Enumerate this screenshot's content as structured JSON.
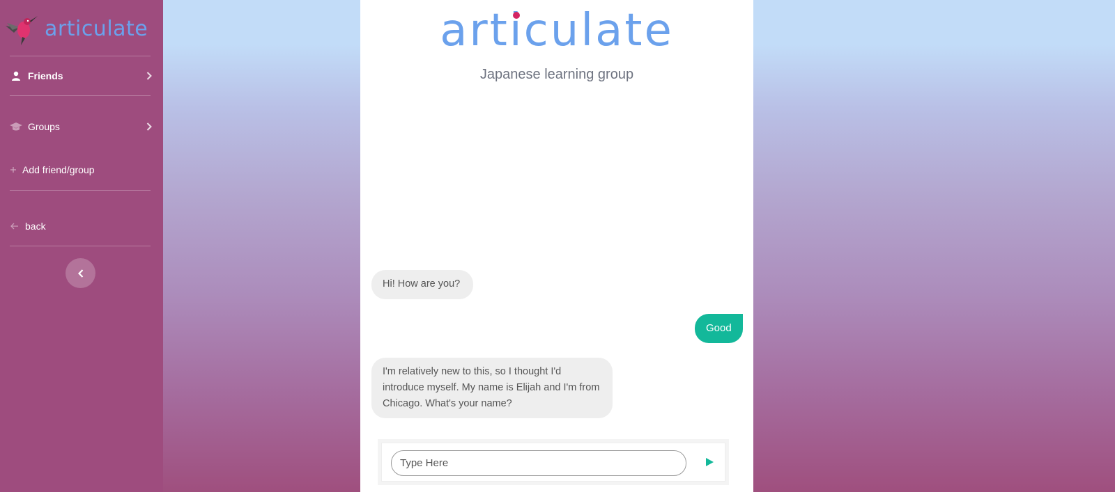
{
  "sidebar": {
    "brand": "articulate",
    "items": {
      "friends": "Friends",
      "groups": "Groups",
      "add": "Add friend/group",
      "back": "back"
    }
  },
  "chat": {
    "logo": "articulate",
    "subtitle": "Japanese learning group",
    "messages": [
      {
        "from": "other",
        "text": "Hi! How are you?"
      },
      {
        "from": "me",
        "text": "Good"
      },
      {
        "from": "other",
        "text": "I'm relatively new to this, so I thought I'd introduce myself. My name is Elijah and I'm from Chicago. What's your name?"
      }
    ],
    "composer": {
      "placeholder": "Type Here"
    }
  },
  "colors": {
    "sidebar": "#9e4c7e",
    "brand_blue": "#6ba1ec",
    "my_bubble": "#13b89a",
    "their_bubble": "#eeeeee",
    "logo_dot": "#d42563"
  },
  "icons": {
    "brand": "hummingbird-icon",
    "friends": "user-icon",
    "groups": "graduation-cap-icon",
    "add": "plus-icon",
    "back": "arrow-left-icon",
    "collapse": "chevron-left-icon",
    "send": "send-icon"
  }
}
